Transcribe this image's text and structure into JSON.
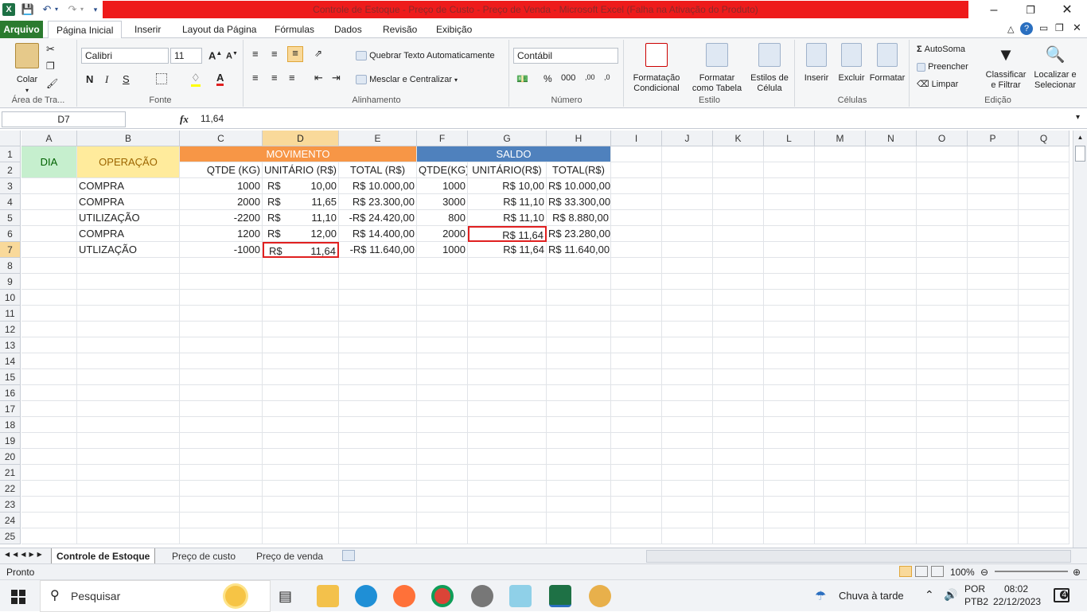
{
  "titlebar": {
    "title": "Controle de Estoque - Preço de Custo - Preço de Venda -  Microsoft Excel (Falha na Ativação do Produto)"
  },
  "tabs": [
    "Página Inicial",
    "Inserir",
    "Layout da Página",
    "Fórmulas",
    "Dados",
    "Revisão",
    "Exibição"
  ],
  "file_tab": "Arquivo",
  "ribbon": {
    "clipboard": {
      "paste": "Colar",
      "label": "Área de Tra..."
    },
    "font": {
      "name": "Calibri",
      "size": "11",
      "label": "Fonte",
      "bold": "N",
      "italic": "I",
      "underline": "S"
    },
    "alignment": {
      "wrap": "Quebrar Texto Automaticamente",
      "merge": "Mesclar e Centralizar",
      "label": "Alinhamento"
    },
    "number": {
      "format": "Contábil",
      "percent": "%",
      "thousands": "000",
      "label": "Número"
    },
    "styles": {
      "cond1": "Formatação",
      "cond2": "Condicional",
      "table1": "Formatar",
      "table2": "como Tabela",
      "cell1": "Estilos de",
      "cell2": "Célula",
      "label": "Estilo"
    },
    "cells": {
      "insert": "Inserir",
      "delete": "Excluir",
      "format": "Formatar",
      "label": "Células"
    },
    "editing": {
      "autosum": "AutoSoma",
      "fill": "Preencher",
      "clear": "Limpar",
      "sort1": "Classificar",
      "sort2": "e Filtrar",
      "find1": "Localizar e",
      "find2": "Selecionar",
      "label": "Edição"
    }
  },
  "formula": {
    "namebox": "D7",
    "fx": "fx",
    "value": "11,64"
  },
  "columns": [
    "A",
    "B",
    "C",
    "D",
    "E",
    "F",
    "G",
    "H",
    "I",
    "J",
    "K",
    "L",
    "M",
    "N",
    "O",
    "P",
    "Q"
  ],
  "rows": [
    "1",
    "2",
    "3",
    "4",
    "5",
    "6",
    "7",
    "8",
    "9",
    "10",
    "11",
    "12",
    "13",
    "14",
    "15",
    "16",
    "17",
    "18",
    "19",
    "20",
    "21",
    "22",
    "23",
    "24",
    "25"
  ],
  "sheet": {
    "dia": "DIA",
    "operacao": "OPERAÇÃO",
    "movimento": "MOVIMENTO",
    "saldo": "SALDO",
    "headers": [
      "QTDE (KG)",
      "UNITÁRIO (R$)",
      "TOTAL (R$)",
      "QTDE(KG)",
      "UNITÁRIO(R$)",
      "TOTAL(R$)"
    ],
    "currency": "R$",
    "data": [
      {
        "op": "COMPRA",
        "qtde": "1000",
        "unit": "10,00",
        "total": "R$ 10.000,00",
        "sqtde": "1000",
        "sunit": "R$ 10,00",
        "stotal": "R$ 10.000,00"
      },
      {
        "op": "COMPRA",
        "qtde": "2000",
        "unit": "11,65",
        "total": "R$ 23.300,00",
        "sqtde": "3000",
        "sunit": "R$ 11,10",
        "stotal": "R$ 33.300,00"
      },
      {
        "op": "UTILIZAÇÃO",
        "qtde": "-2200",
        "unit": "11,10",
        "total": "-R$ 24.420,00",
        "sqtde": "800",
        "sunit": "R$ 11,10",
        "stotal": "R$ 8.880,00"
      },
      {
        "op": "COMPRA",
        "qtde": "1200",
        "unit": "12,00",
        "total": "R$ 14.400,00",
        "sqtde": "2000",
        "sunit": "R$ 11,64",
        "stotal": "R$ 23.280,00"
      },
      {
        "op": "UTLIZAÇÃO",
        "qtde": "-1000",
        "unit": "11,64",
        "total": "-R$ 11.640,00",
        "sqtde": "1000",
        "sunit": "R$ 11,64",
        "stotal": "R$ 11.640,00"
      }
    ]
  },
  "sheet_tabs": [
    "Controle de Estoque",
    "Preço de custo",
    "Preço de venda"
  ],
  "status": {
    "ready": "Pronto",
    "zoom": "100%"
  },
  "taskbar": {
    "search": "Pesquisar",
    "weather": "Chuva à tarde",
    "lang1": "POR",
    "lang2": "PTB2",
    "time": "08:02",
    "date": "22/12/2023",
    "notif": "4"
  },
  "colors": {
    "movimento": "#f79646",
    "saldo": "#4f81bd",
    "dia": "#c6efce",
    "operacao": "#ffeb9c",
    "operacao_text": "#9c6500",
    "dia_text": "#006100",
    "highlight": "#e02020"
  }
}
